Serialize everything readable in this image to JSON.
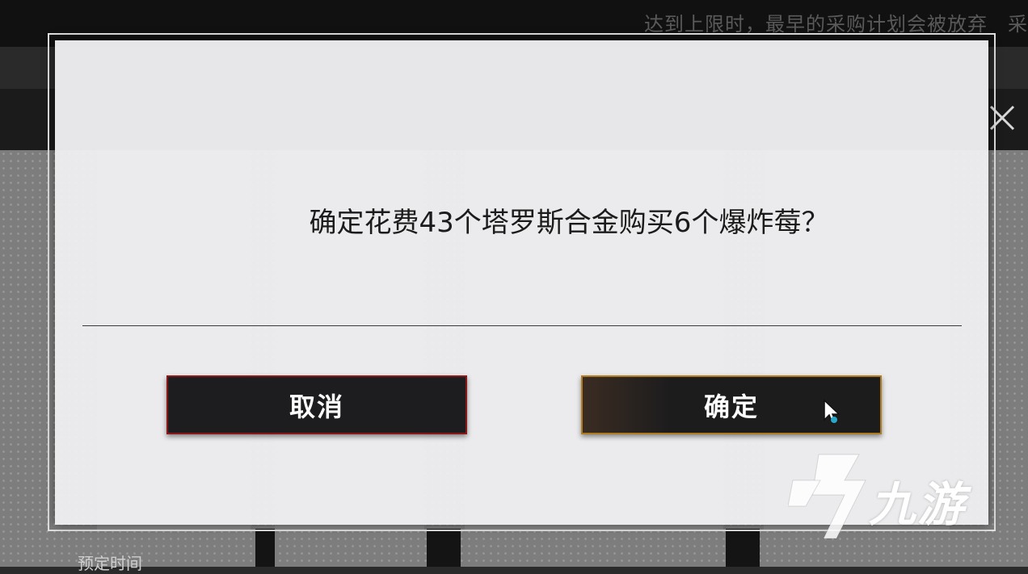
{
  "background": {
    "notice": "达到上限时，最早的采购计划会被放弃　采",
    "footer_label": "预定时间"
  },
  "dialog": {
    "message": "确定花费43个塔罗斯合金购买6个爆炸莓？",
    "cancel_label": "取消",
    "confirm_label": "确定"
  },
  "watermark": {
    "text": "九游"
  },
  "colors": {
    "cancel_border": "#8a1818",
    "confirm_border": "#b07a1f",
    "dialog_bg": "#eeeef0"
  }
}
